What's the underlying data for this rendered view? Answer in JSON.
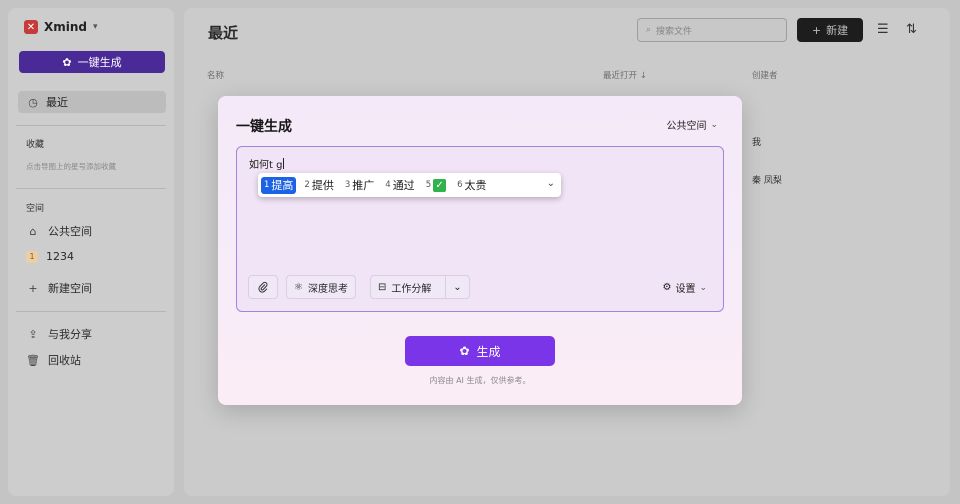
{
  "app": {
    "brand": "Xmind",
    "generate_button": "一键生成",
    "nav_recent": "最近",
    "favorites_label": "收藏",
    "favorites_hint": "点击导图上的星号添加收藏",
    "spaces_label": "空间",
    "spaces": [
      {
        "label": "公共空间"
      },
      {
        "label": "1234",
        "badge": "1"
      },
      {
        "label": "新建空间"
      }
    ],
    "shared": "与我分享",
    "trash": "回收站"
  },
  "main": {
    "title": "最近",
    "search_placeholder": "搜索文件",
    "new_button": "新建",
    "columns": {
      "name": "名称",
      "last_opened": "最近打开 ↓",
      "creator": "创建者"
    },
    "creators": [
      "我",
      "秦 凤梨"
    ]
  },
  "dialog": {
    "title": "一键生成",
    "space": "公共空间",
    "input_text": "如何t g",
    "ime_candidates": [
      {
        "num": "1",
        "text": "提高",
        "selected": true
      },
      {
        "num": "2",
        "text": "提供"
      },
      {
        "num": "3",
        "text": "推广"
      },
      {
        "num": "4",
        "text": "通过"
      },
      {
        "num": "5",
        "text": "✓"
      },
      {
        "num": "6",
        "text": "太贵"
      }
    ],
    "deep_think": "深度思考",
    "work_breakdown": "工作分解",
    "settings": "设置",
    "generate": "生成",
    "disclaimer": "内容由 AI 生成，仅供参考。"
  },
  "colors": {
    "primary": "#7b35e8",
    "ime_selected": "#1c62e5",
    "editor_border": "#a781dc"
  }
}
